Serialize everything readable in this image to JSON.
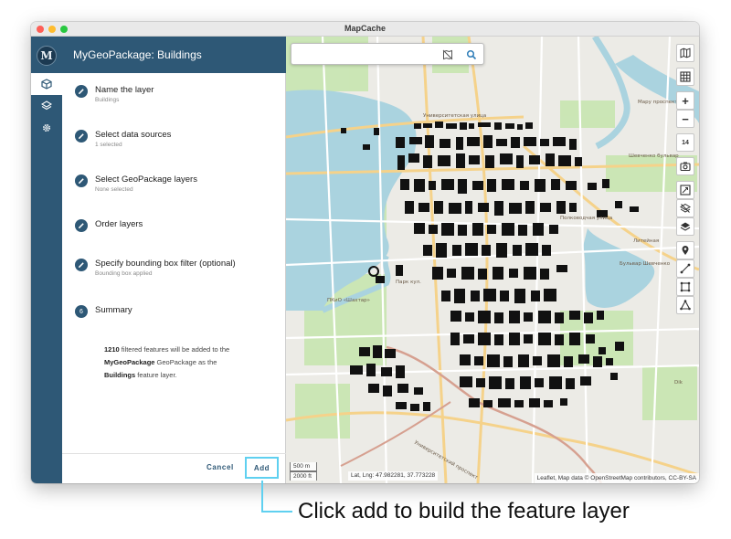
{
  "window": {
    "title": "MapCache"
  },
  "rail": {
    "logo": "M",
    "items": [
      "cube-icon",
      "layers-icon",
      "settings-gear-icon"
    ]
  },
  "panel": {
    "title": "MyGeoPackage: Buildings",
    "steps": [
      {
        "title": "Name the layer",
        "subtitle": "Buildings",
        "state": "done"
      },
      {
        "title": "Select data sources",
        "subtitle": "1 selected",
        "state": "done"
      },
      {
        "title": "Select GeoPackage layers",
        "subtitle": "None selected",
        "state": "done"
      },
      {
        "title": "Order layers",
        "subtitle": "",
        "state": "done"
      },
      {
        "title": "Specify bounding box filter (optional)",
        "subtitle": "Bounding box applied",
        "state": "done"
      },
      {
        "title": "Summary",
        "subtitle": "",
        "number": "6",
        "state": "active"
      }
    ],
    "summary": {
      "count": "1210",
      "text1": " filtered features will be added to the",
      "geopackage": "MyGeoPackage",
      "text2": " GeoPackage as the",
      "layer": "Buildings",
      "text3": " feature layer."
    },
    "footer": {
      "cancel_label": "Cancel",
      "add_label": "Add"
    }
  },
  "map": {
    "search": {
      "value": "",
      "placeholder": ""
    },
    "zoom_in": "+",
    "zoom_out": "−",
    "zoom_level": "14",
    "scale_metric": "500 m",
    "scale_imperial": "2000 ft",
    "coordinates": "Lat, Lng: 47.982281, 37.773228",
    "attribution": "Leaflet, Map data © OpenStreetMap contributors, CC-BY-SA",
    "labels": [
      "Университетская улица",
      "Мару проспект",
      "Шевченко бульвар",
      "Полководчая улица",
      "Литейная",
      "ПКиО «Шахтар»",
      "Парк кул.",
      "Dik",
      "Бульвар Шевченко",
      "Университетский проспект"
    ]
  },
  "caption": "Click add to build the feature layer",
  "colors": {
    "header": "#2e5876",
    "highlight": "#5fd0f0",
    "map_bg": "#ecebe6",
    "water": "#aad3df",
    "park": "#c8e6b0",
    "building": "#111111"
  }
}
